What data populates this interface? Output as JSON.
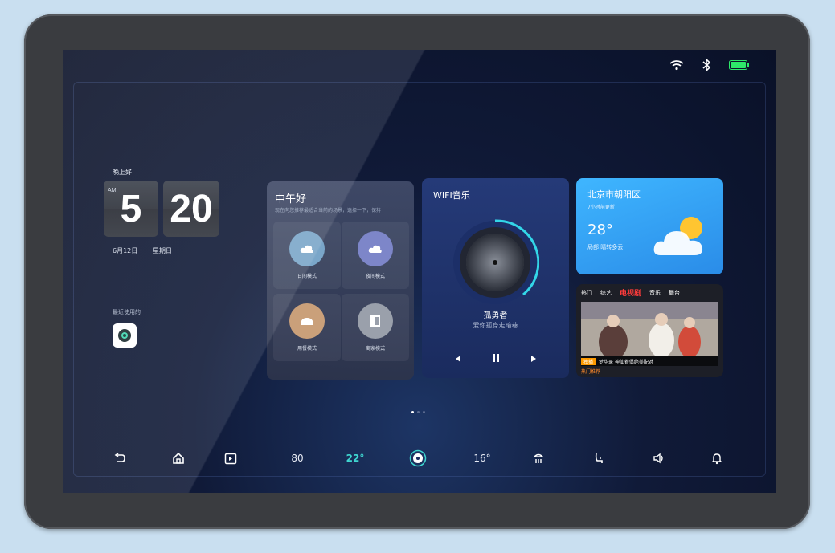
{
  "status_bar": {
    "icons": [
      "wifi-icon",
      "bluetooth-icon",
      "battery-icon"
    ],
    "battery_color": "#2ee86a"
  },
  "clock": {
    "greeting": "晚上好",
    "ampm": "AM",
    "hour": "5",
    "minute": "20",
    "date": "6月12日",
    "weekday": "星期日"
  },
  "recent": {
    "label": "最近使用的"
  },
  "scene_card": {
    "title": "中午好",
    "subtitle": "现在向您推荐最适合当前的场景，选择一下，保持",
    "tiles": [
      {
        "label": "日间模式",
        "color": "#7aa6c9"
      },
      {
        "label": "夜间模式",
        "color": "#7d86c9"
      },
      {
        "label": "用餐模式",
        "color": "#caa07a"
      },
      {
        "label": "离家模式",
        "color": "#9aa0ab"
      }
    ]
  },
  "music_card": {
    "title": "WIFI音乐",
    "song": "孤勇者",
    "artist": "爱你孤身走暗巷",
    "accent_color": "#33d6e8"
  },
  "weather_card": {
    "city": "北京市朝阳区",
    "sub": "7小时前更新",
    "temp": "28°",
    "desc": "局部 晴转多云"
  },
  "video_card": {
    "tabs": [
      "热门",
      "综艺",
      "电视剧",
      "音乐",
      "舞台"
    ],
    "active_tab": "电视剧",
    "caption_tag": "独播",
    "caption": "梦华录 神仙眷侣绝美配对",
    "sub": "热门推荐"
  },
  "dock": {
    "items": [
      {
        "name": "back-icon",
        "text": ""
      },
      {
        "name": "home-icon",
        "text": ""
      },
      {
        "name": "media-icon",
        "text": ""
      },
      {
        "name": "climate-fan",
        "text": "80"
      },
      {
        "name": "temperature-driver",
        "text": "22°"
      },
      {
        "name": "fan-icon",
        "text": ""
      },
      {
        "name": "temperature-passenger",
        "text": "16°"
      },
      {
        "name": "seat-heat-icon",
        "text": ""
      },
      {
        "name": "seat-icon",
        "text": ""
      },
      {
        "name": "volume-icon",
        "text": ""
      },
      {
        "name": "notification-icon",
        "text": ""
      }
    ],
    "active_color": "#3fd6d0"
  }
}
